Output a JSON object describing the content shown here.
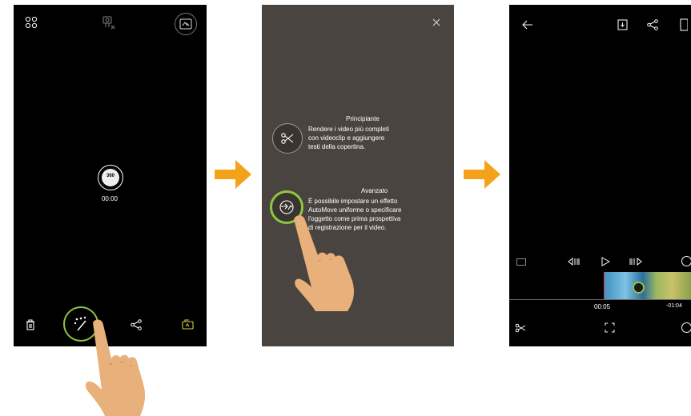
{
  "screen1": {
    "timer": "00:00",
    "badge_360": "360",
    "icons": [
      "grid-icon",
      "camera-settings-icon",
      "panorama-mode-icon",
      "delete-icon",
      "magic-wand-icon",
      "share-icon",
      "gallery-icon"
    ]
  },
  "screen2": {
    "beginner": {
      "title": "Principiante",
      "lines": [
        "Rendere i video più completi",
        "con videoclip e aggiungere",
        "testi della copertina."
      ]
    },
    "advanced": {
      "title": "Avanzato",
      "lines": [
        "È possibile impostare un effetto",
        "AutoMove uniforme o specificare",
        "l'oggetto come prima prospettiva",
        "di registrazione per il video."
      ]
    }
  },
  "screen3": {
    "current_time": "00:05",
    "remaining_time": "-01:04"
  },
  "colors": {
    "accent_green": "#8dc63f",
    "arrow_orange": "#f5a21b",
    "hand_skin": "#e8b07a",
    "overlay_bg": "#4a4440",
    "yellow_icon": "#d8d338"
  }
}
